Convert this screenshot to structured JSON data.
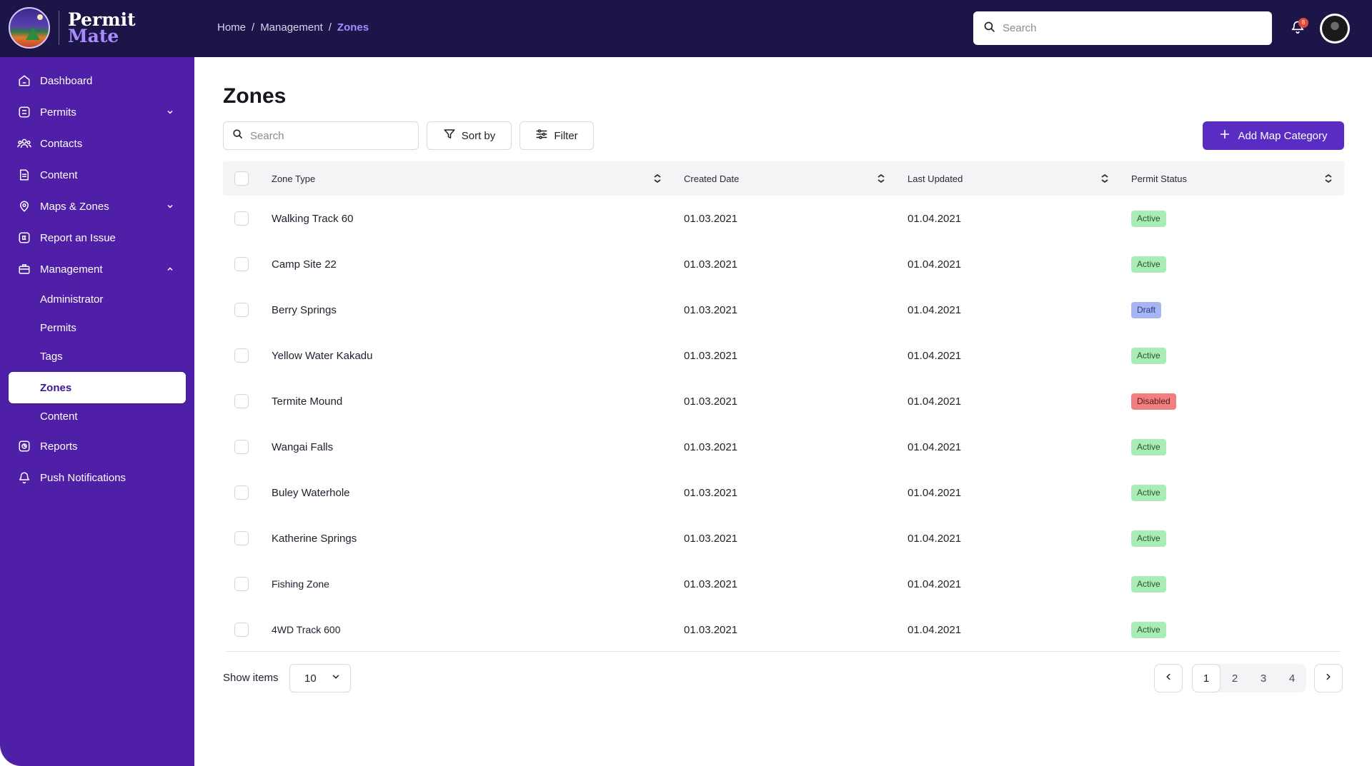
{
  "app": {
    "name_line1": "Permit",
    "name_line2": "Mate"
  },
  "breadcrumb": {
    "home": "Home",
    "management": "Management",
    "current": "Zones",
    "separator": "/"
  },
  "header": {
    "search_placeholder": "Search",
    "notification_count": "8"
  },
  "sidebar": {
    "dashboard": "Dashboard",
    "permits": "Permits",
    "contacts": "Contacts",
    "content": "Content",
    "maps_zones": "Maps & Zones",
    "report_issue": "Report an Issue",
    "management": "Management",
    "sub": {
      "administrator": "Administrator",
      "permits": "Permits",
      "tags": "Tags",
      "zones": "Zones",
      "content": "Content"
    },
    "reports": "Reports",
    "push_notifications": "Push Notifications"
  },
  "page": {
    "title": "Zones"
  },
  "toolbar": {
    "search_placeholder": "Search",
    "sort_label": "Sort by",
    "filter_label": "Filter",
    "add_label": "Add Map Category"
  },
  "table": {
    "columns": {
      "zone_type": "Zone Type",
      "created": "Created Date",
      "updated": "Last Updated",
      "status": "Permit Status"
    },
    "rows": [
      {
        "zone": "Walking Track 60",
        "created": "01.03.2021",
        "updated": "01.04.2021",
        "status": "Active"
      },
      {
        "zone": "Camp Site 22",
        "created": "01.03.2021",
        "updated": "01.04.2021",
        "status": "Active"
      },
      {
        "zone": "Berry Springs",
        "created": "01.03.2021",
        "updated": "01.04.2021",
        "status": "Draft"
      },
      {
        "zone": "Yellow Water Kakadu",
        "created": "01.03.2021",
        "updated": "01.04.2021",
        "status": "Active"
      },
      {
        "zone": "Termite Mound",
        "created": "01.03.2021",
        "updated": "01.04.2021",
        "status": "Disabled"
      },
      {
        "zone": "Wangai Falls",
        "created": "01.03.2021",
        "updated": "01.04.2021",
        "status": "Active"
      },
      {
        "zone": "Buley Waterhole",
        "created": "01.03.2021",
        "updated": "01.04.2021",
        "status": "Active"
      },
      {
        "zone": "Katherine Springs",
        "created": "01.03.2021",
        "updated": "01.04.2021",
        "status": "Active"
      },
      {
        "zone": "Fishing Zone",
        "created": "01.03.2021",
        "updated": "01.04.2021",
        "status": "Active"
      },
      {
        "zone": "4WD Track 600",
        "created": "01.03.2021",
        "updated": "01.04.2021",
        "status": "Active"
      }
    ]
  },
  "footer": {
    "show_items_label": "Show items",
    "page_size": "10",
    "pages": [
      "1",
      "2",
      "3",
      "4"
    ],
    "current_page": "1"
  },
  "colors": {
    "topbar": "#1b1548",
    "sidebar": "#4f1fa8",
    "accent": "#5a2cc4",
    "active_badge": "#a9ecb4",
    "draft_badge": "#a6b6f2",
    "disabled_badge": "#f08080"
  }
}
